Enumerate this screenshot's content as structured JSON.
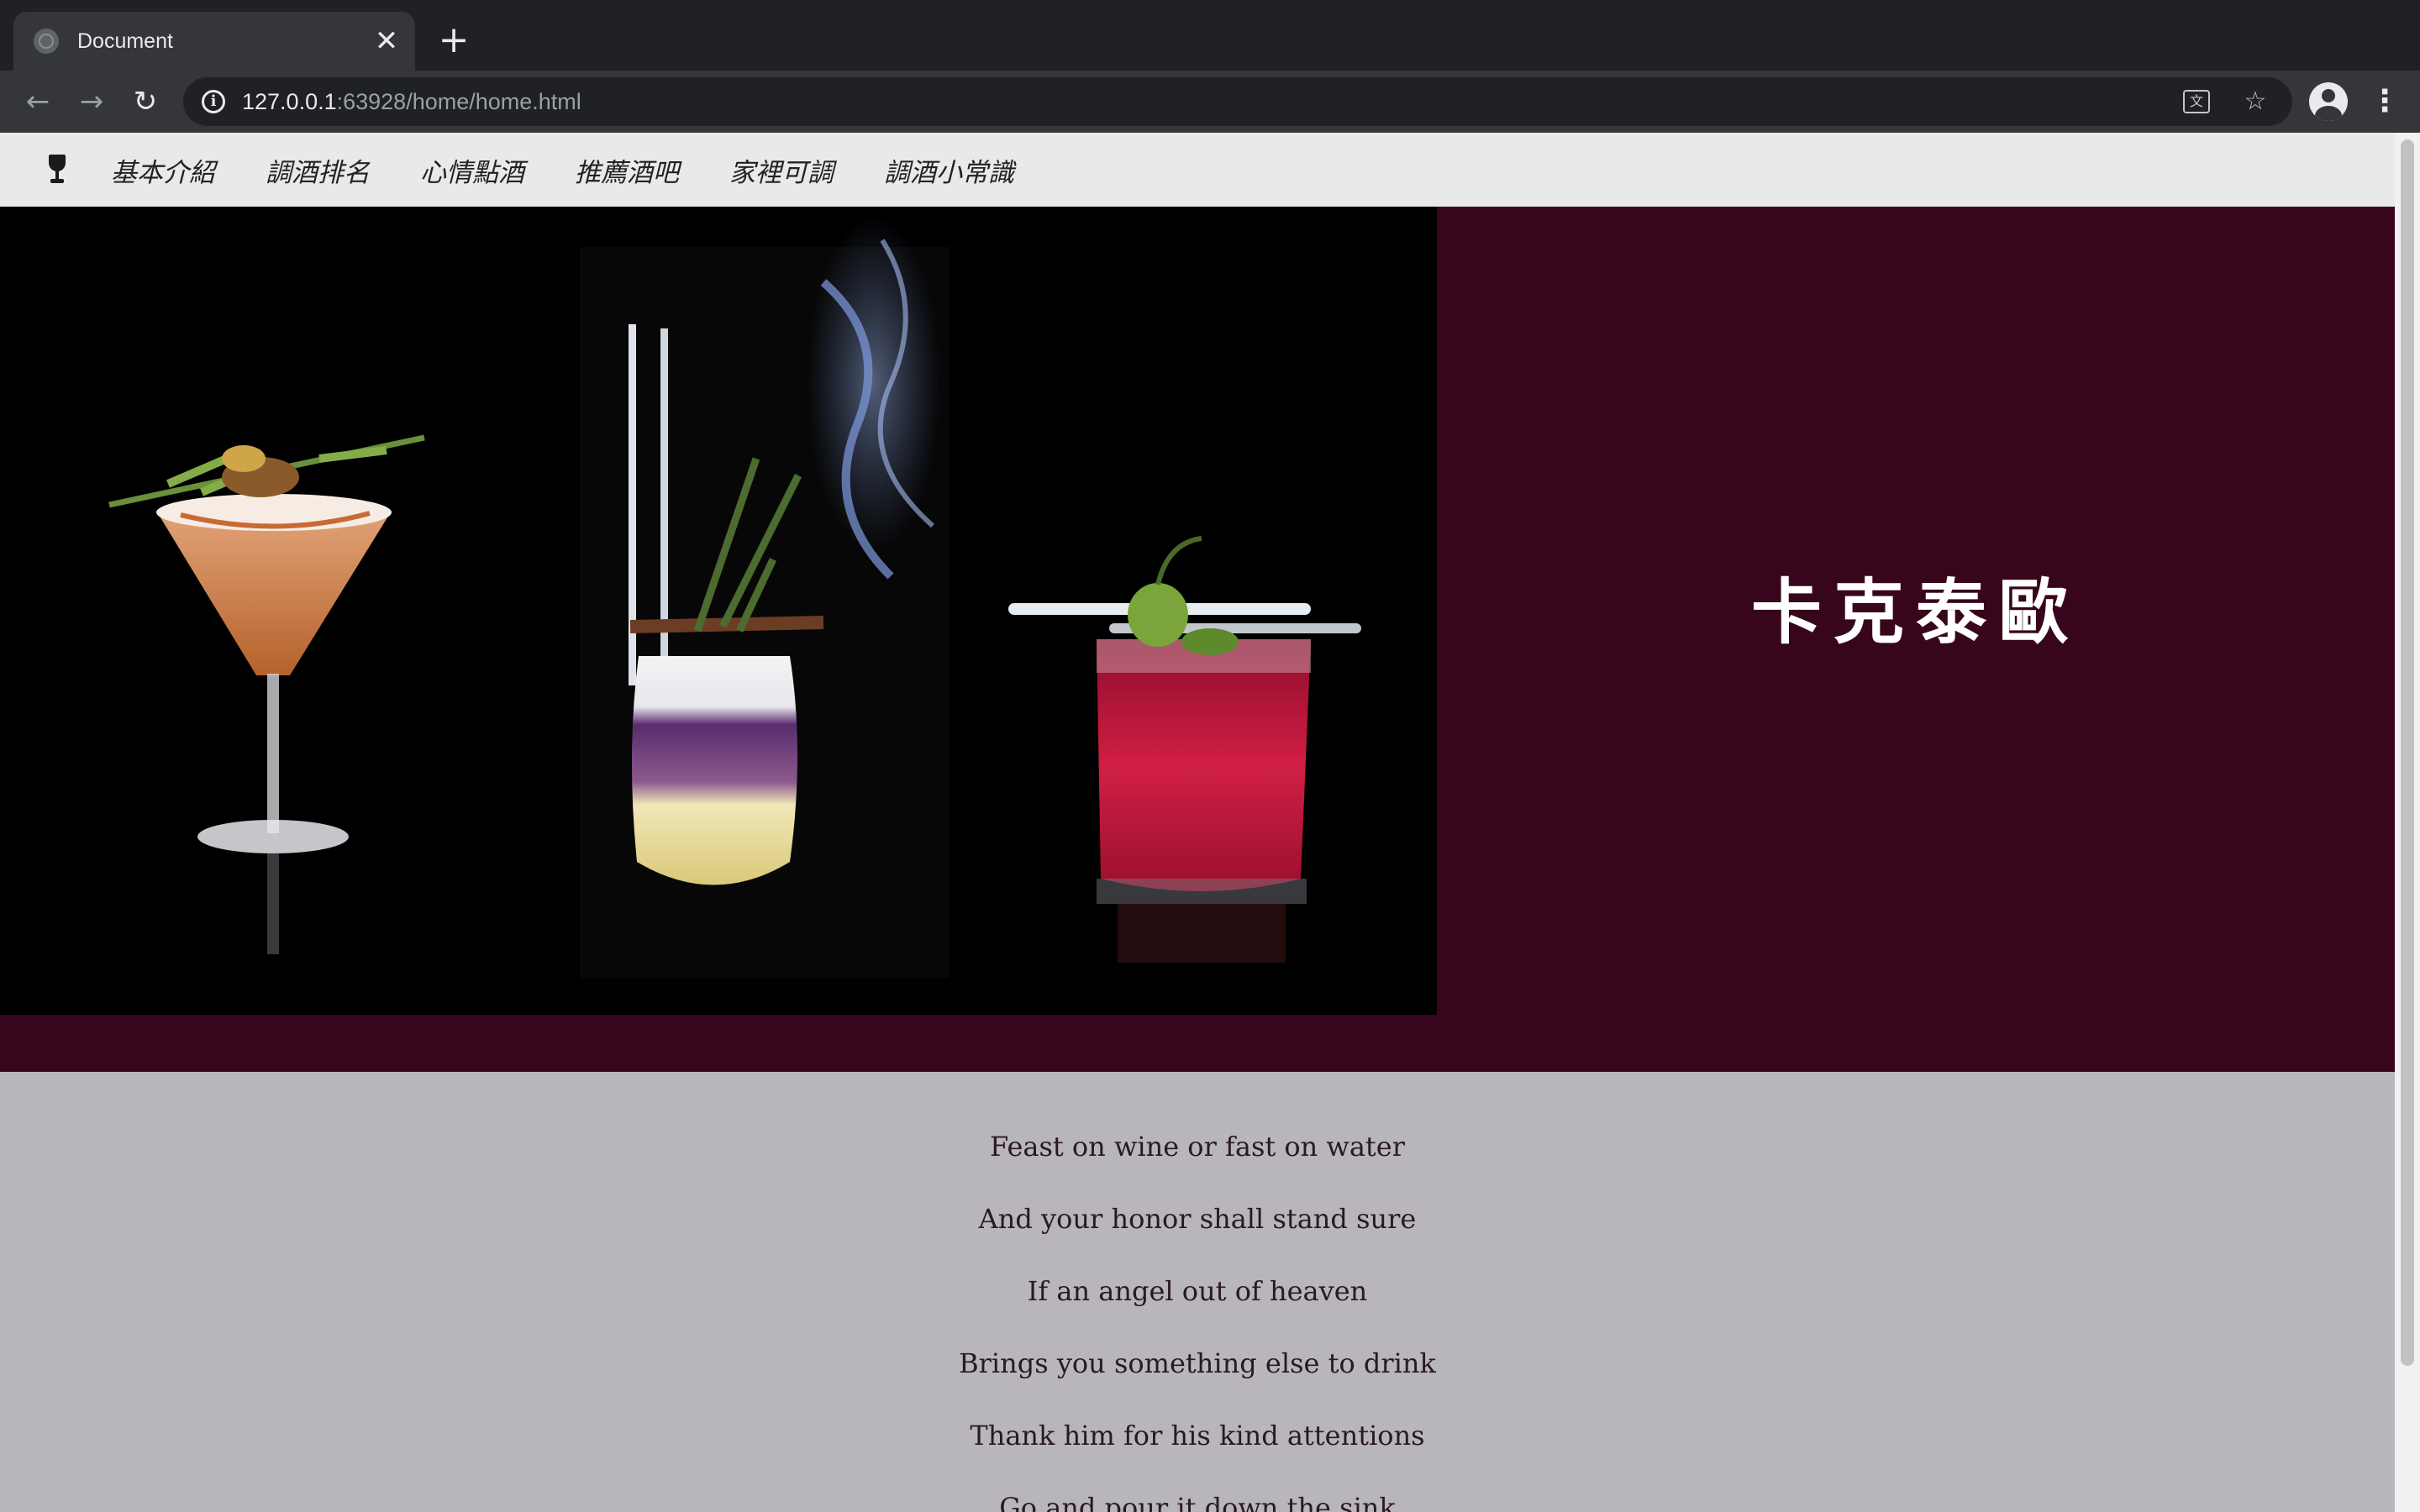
{
  "browser": {
    "tab": {
      "title": "Document",
      "close_glyph": "✕"
    },
    "new_tab_glyph": "+",
    "nav": {
      "back_glyph": "←",
      "forward_glyph": "→",
      "reload_glyph": "↻"
    },
    "address": {
      "host": "127.0.0.1",
      "rest": ":63928/home/home.html"
    },
    "icons": [
      "info-icon",
      "translate-icon",
      "star-icon",
      "account-icon",
      "menu-icon"
    ],
    "menu_glyph": "⋮",
    "star_glyph": "☆",
    "translate_glyph": "文"
  },
  "site": {
    "nav_items": [
      "基本介紹",
      "調酒排名",
      "心情點酒",
      "推薦酒吧",
      "家裡可調",
      "調酒小常識"
    ],
    "hero_title": "卡克泰歐",
    "hero_bg": "#38061c",
    "hero_photo_desc_icons": [
      "martini-glass",
      "smoked-highball",
      "red-rocks-glass"
    ],
    "poem": [
      "Feast on wine or fast on water",
      "And your honor shall stand sure",
      "If an angel out of heaven",
      "Brings you something else to drink",
      "Thank him for his kind attentions",
      "Go and pour it down the sink"
    ]
  }
}
